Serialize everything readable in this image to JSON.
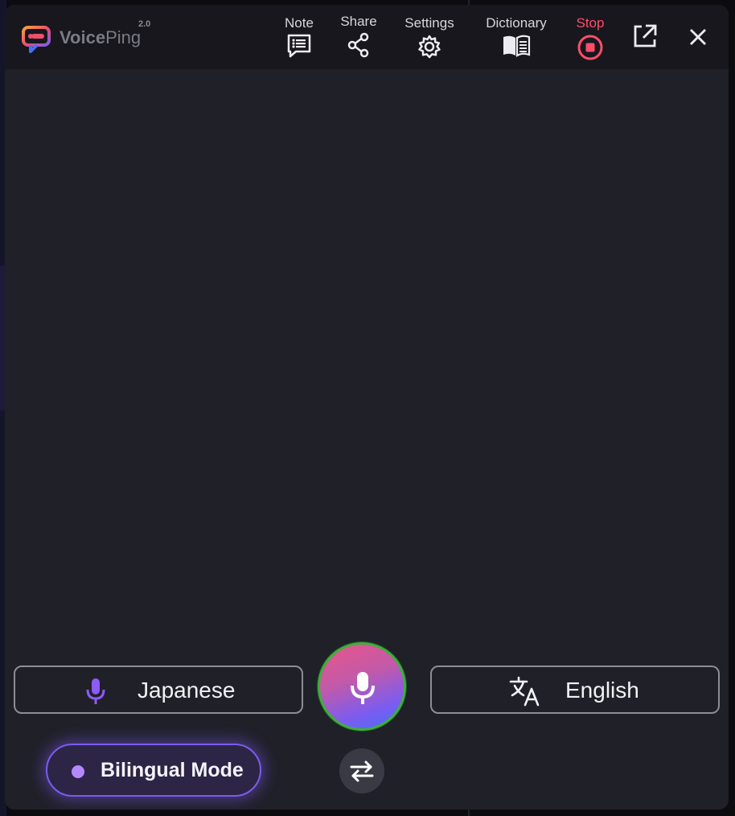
{
  "app": {
    "logo_text_bold": "Voice",
    "logo_text_regular": "Ping",
    "version": "2.0"
  },
  "toolbar": {
    "note_label": "Note",
    "share_label": "Share",
    "settings_label": "Settings",
    "dictionary_label": "Dictionary",
    "stop_label": "Stop",
    "icons": {
      "note": "note-list-icon",
      "share": "share-icon",
      "settings": "gear-icon",
      "dictionary": "book-icon",
      "stop": "stop-circle-icon",
      "popout": "external-link-icon",
      "close": "close-icon"
    }
  },
  "controls": {
    "source_language": "Japanese",
    "target_language": "English",
    "bilingual_mode_label": "Bilingual Mode",
    "icons": {
      "source": "microphone-icon",
      "target": "translate-icon",
      "main": "microphone-icon",
      "swap": "swap-arrows-icon"
    }
  },
  "colors": {
    "window_bg": "#202029",
    "titlebar_bg": "#17171d",
    "stop_red": "#ff4d6a",
    "accent_purple": "#7a5cf0",
    "mic_ring_green": "#3fae3f"
  }
}
